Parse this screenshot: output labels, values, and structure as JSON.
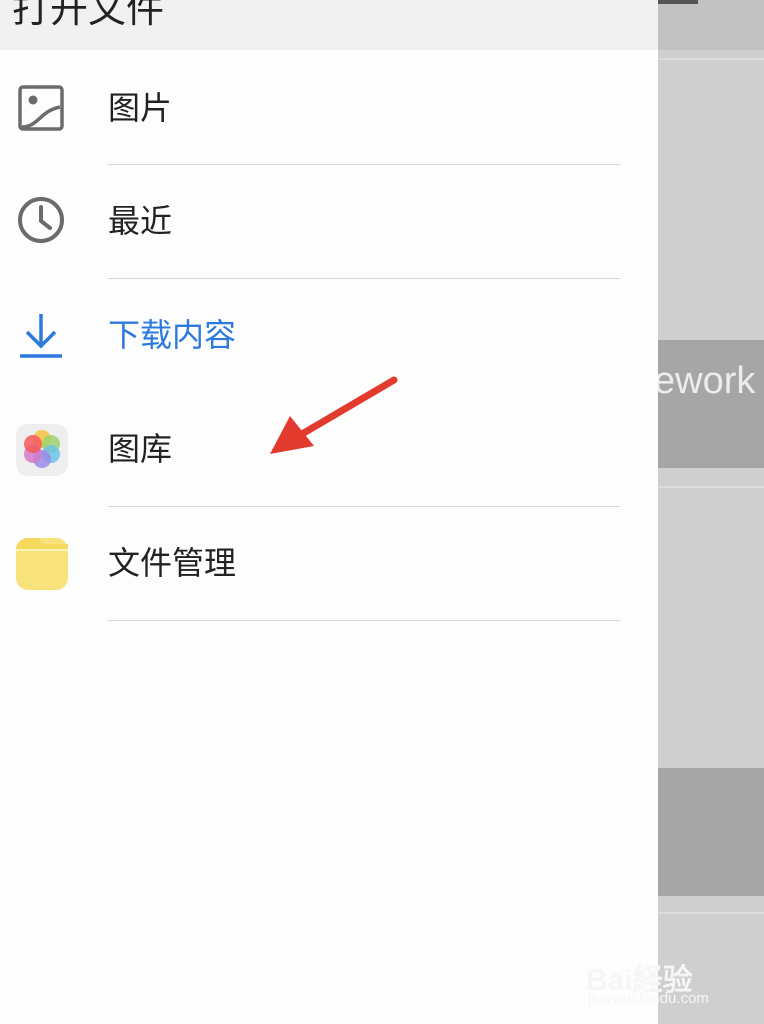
{
  "drawer": {
    "title": "打开文件",
    "items": [
      {
        "label": "图片",
        "icon": "image-icon",
        "accent": false
      },
      {
        "label": "最近",
        "icon": "clock-icon",
        "accent": false
      },
      {
        "label": "下载内容",
        "icon": "download-icon",
        "accent": true
      },
      {
        "label": "图库",
        "icon": "gallery-app-icon",
        "accent": false
      },
      {
        "label": "文件管理",
        "icon": "folder-app-icon",
        "accent": false
      }
    ]
  },
  "background": {
    "card_text": "ework"
  },
  "watermark": {
    "main": "Bai経验",
    "sub": "jingyan.baidu.com"
  },
  "colors": {
    "accent": "#2c7ae0",
    "annotation": "#e23a2c",
    "text": "#222222"
  }
}
